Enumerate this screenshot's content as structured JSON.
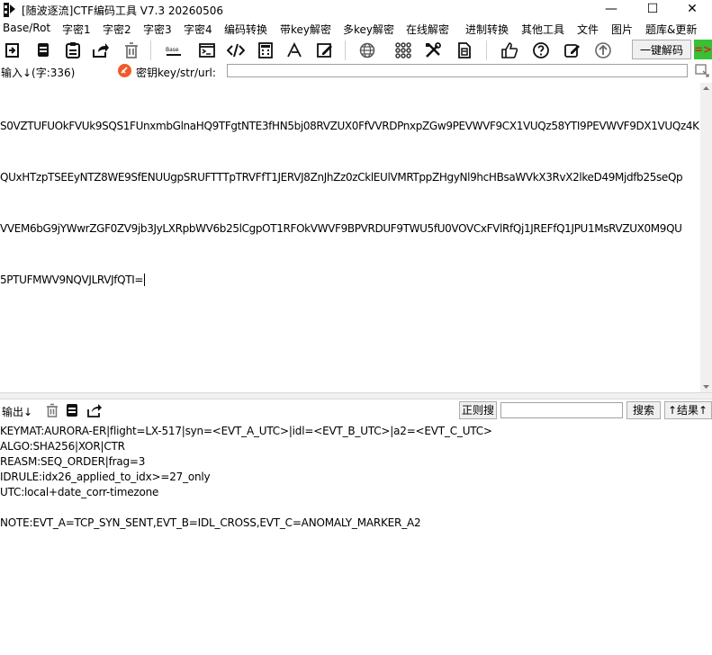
{
  "window": {
    "title": "[随波逐流]CTF编码工具 V7.3  20260506",
    "minimize": "—",
    "maximize": "☐",
    "close": "✕"
  },
  "menu": [
    "Base/Rot",
    "字密1",
    "字密2",
    "字密3",
    "字密4",
    "编码转换",
    "带key解密",
    "多key解密",
    "在线解密",
    "进制转换",
    "其他工具",
    "文件",
    "图片",
    "题库&更新"
  ],
  "toolbar": {
    "decode_label": "一键解码",
    "eq_label": "=>",
    "base_icon_text": "Base"
  },
  "input": {
    "label": "输入↓(字:336)",
    "key_label": "密钥key/str/url:",
    "key_value": "",
    "lines": [
      "S0VZTUFUOkFVUk9SQS1FUnxmbGlnaHQ9TFgtNTE3fHN5bj08RVZUX0FfVVRDPnxpZGw9PEVWVF9CX1VUQz58YTI9PEVWVF9DX1VUQz4K",
      "QUxHTzpTSEEyNTZ8WE9SfENUUgpSRUFTTTpTRVFfT1JERVJ8ZnJhZz0zCklEUlVMRTppZHgyNl9hcHBsaWVkX3RvX2lkeD49Mjdfb25seQp",
      "VVEM6bG9jYWwrZGF0ZV9jb3JyLXRpbWV6b25lCgpOT1RFOkVWVF9BPVRDUF9TWU5fU0VOVCxFVlRfQj1JREFfQ1JPU1MsRVZUX0M9QU",
      "5PTUFMWV9NQVJLRVJfQTI="
    ]
  },
  "output": {
    "label": "输出↓",
    "regex_label": "正则搜",
    "search_value": "",
    "search_label": "搜索",
    "result_label": "↑结果↑",
    "lines": [
      "KEYMAT:AURORA-ER|flight=LX-517|syn=<EVT_A_UTC>|idl=<EVT_B_UTC>|a2=<EVT_C_UTC>",
      "ALGO:SHA256|XOR|CTR",
      "REASM:SEQ_ORDER|frag=3",
      "IDRULE:idx26_applied_to_idx>=27_only",
      "UTC:local+date_corr-timezone",
      "",
      "NOTE:EVT_A=TCP_SYN_SENT,EVT_B=IDL_CROSS,EVT_C=ANOMALY_MARKER_A2"
    ]
  }
}
